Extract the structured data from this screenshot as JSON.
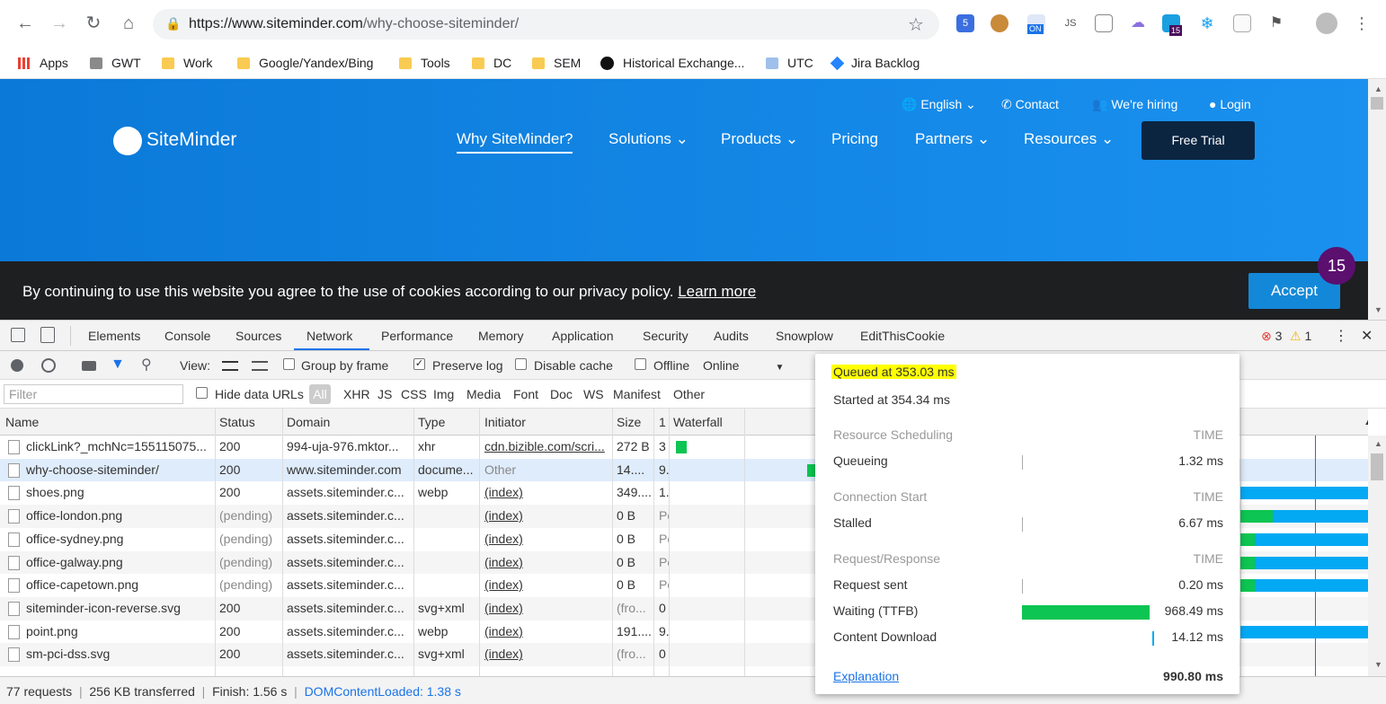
{
  "browser": {
    "url_domain": "https://www.siteminder.com",
    "url_path": "/why-choose-siteminder/",
    "ext_badge_on": "ON",
    "ext_badge_15": "15",
    "ext_js": "JS"
  },
  "bookmarks": [
    {
      "label": "Apps",
      "icon": "apps-grid-icon"
    },
    {
      "label": "GWT",
      "icon": "gwt-icon"
    },
    {
      "label": "Work",
      "icon": "folder-icon"
    },
    {
      "label": "Google/Yandex/Bing",
      "icon": "folder-icon"
    },
    {
      "label": "Tools",
      "icon": "folder-icon"
    },
    {
      "label": "DC",
      "icon": "folder-icon"
    },
    {
      "label": "SEM",
      "icon": "folder-icon"
    },
    {
      "label": "Historical Exchange...",
      "icon": "notion-icon"
    },
    {
      "label": "UTC",
      "icon": "utc-icon"
    },
    {
      "label": "Jira Backlog",
      "icon": "jira-icon"
    }
  ],
  "site": {
    "logo_text": "SiteMinder",
    "top_links": {
      "english": "English",
      "contact": "Contact",
      "hiring": "We're hiring",
      "login": "Login"
    },
    "nav": {
      "why": "Why SiteMinder?",
      "solutions": "Solutions",
      "products": "Products",
      "pricing": "Pricing",
      "partners": "Partners",
      "resources": "Resources"
    },
    "free_trial": "Free Trial",
    "cookie_text": "By continuing to use this website you agree to the use of cookies according to our privacy policy.",
    "cookie_link": "Learn more",
    "accept": "Accept",
    "badge": "15"
  },
  "devtools": {
    "tabs": [
      "Elements",
      "Console",
      "Sources",
      "Network",
      "Performance",
      "Memory",
      "Application",
      "Security",
      "Audits",
      "Snowplow",
      "EditThisCookie"
    ],
    "active_tab": "Network",
    "errors": "3",
    "warnings": "1",
    "toolbar": {
      "view": "View:",
      "group_by_frame": "Group by frame",
      "preserve_log": "Preserve log",
      "disable_cache": "Disable cache",
      "offline": "Offline",
      "online": "Online"
    },
    "filter": {
      "placeholder": "Filter",
      "hide_data_urls": "Hide data URLs",
      "all": "All",
      "types": [
        "XHR",
        "JS",
        "CSS",
        "Img",
        "Media",
        "Font",
        "Doc",
        "WS",
        "Manifest",
        "Other"
      ]
    },
    "columns": {
      "name": "Name",
      "status": "Status",
      "domain": "Domain",
      "type": "Type",
      "initiator": "Initiator",
      "size": "Size",
      "time": "1",
      "waterfall": "Waterfall"
    },
    "rows": [
      {
        "name": "clickLink?_mchNc=155115075...",
        "status": "200",
        "domain": "994-uja-976.mktor...",
        "type": "xhr",
        "initiator": "cdn.bizible.com/scri...",
        "size": "272 B",
        "time": "3"
      },
      {
        "name": "why-choose-siteminder/",
        "status": "200",
        "domain": "www.siteminder.com",
        "type": "docume...",
        "initiator": "Other",
        "size": "14....",
        "time": "9."
      },
      {
        "name": "shoes.png",
        "status": "200",
        "domain": "assets.siteminder.c...",
        "type": "webp",
        "initiator": "(index)",
        "size": "349....",
        "time": "1."
      },
      {
        "name": "office-london.png",
        "status": "(pending)",
        "domain": "assets.siteminder.c...",
        "type": "",
        "initiator": "(index)",
        "size": "0 B",
        "time": "Pe"
      },
      {
        "name": "office-sydney.png",
        "status": "(pending)",
        "domain": "assets.siteminder.c...",
        "type": "",
        "initiator": "(index)",
        "size": "0 B",
        "time": "Pe"
      },
      {
        "name": "office-galway.png",
        "status": "(pending)",
        "domain": "assets.siteminder.c...",
        "type": "",
        "initiator": "(index)",
        "size": "0 B",
        "time": "Pe"
      },
      {
        "name": "office-capetown.png",
        "status": "(pending)",
        "domain": "assets.siteminder.c...",
        "type": "",
        "initiator": "(index)",
        "size": "0 B",
        "time": "Pe"
      },
      {
        "name": "siteminder-icon-reverse.svg",
        "status": "200",
        "domain": "assets.siteminder.c...",
        "type": "svg+xml",
        "initiator": "(index)",
        "size": "(fro...",
        "time": "0"
      },
      {
        "name": "point.png",
        "status": "200",
        "domain": "assets.siteminder.c...",
        "type": "webp",
        "initiator": "(index)",
        "size": "191....",
        "time": "9."
      },
      {
        "name": "sm-pci-dss.svg",
        "status": "200",
        "domain": "assets.siteminder.c...",
        "type": "svg+xml",
        "initiator": "(index)",
        "size": "(fro...",
        "time": "0"
      }
    ],
    "status_bar": {
      "requests": "77 requests",
      "transferred": "256 KB transferred",
      "finish": "Finish: 1.56 s",
      "dcl": "DOMContentLoaded: 1.38 s"
    },
    "timing": {
      "queued_at": "Queued at 353.03 ms",
      "started_at": "Started at 354.34 ms",
      "time_header": "TIME",
      "sections": [
        {
          "title": "Resource Scheduling",
          "items": [
            {
              "label": "Queueing",
              "value": "1.32 ms",
              "fraction": 0.0
            }
          ]
        },
        {
          "title": "Connection Start",
          "items": [
            {
              "label": "Stalled",
              "value": "6.67 ms",
              "fraction": 0.0
            }
          ]
        },
        {
          "title": "Request/Response",
          "items": [
            {
              "label": "Request sent",
              "value": "0.20 ms",
              "fraction": 0.0
            },
            {
              "label": "Waiting (TTFB)",
              "value": "968.49 ms",
              "fraction": 0.977
            },
            {
              "label": "Content Download",
              "value": "14.12 ms",
              "fraction": 0.014
            }
          ]
        }
      ],
      "explanation": "Explanation",
      "total": "990.80 ms"
    }
  },
  "colors": {
    "brand_blue": "#1488d8",
    "ttfb_green": "#0cc552",
    "download_blue": "#04a9f4",
    "highlight": "#ffff00"
  }
}
